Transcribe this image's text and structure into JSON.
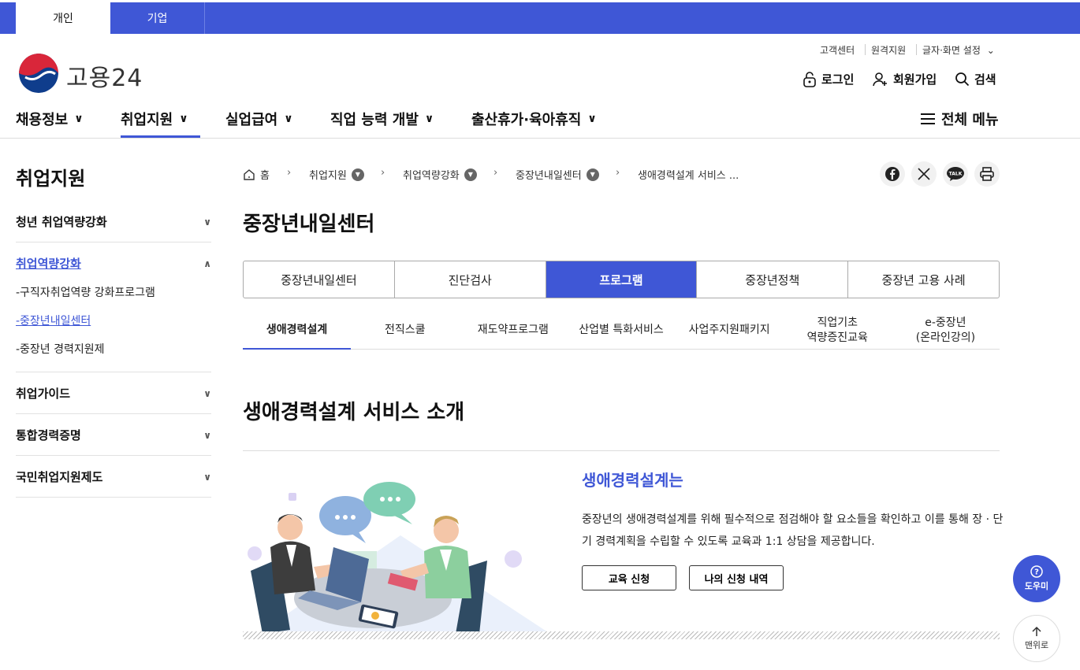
{
  "top_tabs": [
    "개인",
    "기업"
  ],
  "brand": {
    "name": "고용24"
  },
  "utility": {
    "customer_center": "고객센터",
    "remote_support": "원격지원",
    "display_settings": "글자·화면 설정"
  },
  "account": {
    "login": "로그인",
    "signup": "회원가입",
    "search": "검색"
  },
  "gnb": [
    "채용정보",
    "취업지원",
    "실업급여",
    "직업 능력 개발",
    "출산휴가·육아휴직"
  ],
  "all_menu": "전체 메뉴",
  "sidebar": {
    "title": "취업지원",
    "items": [
      {
        "label": "청년 취업역량강화"
      },
      {
        "label": "취업역량강화",
        "sub": [
          "-구직자취업역량 강화프로그램",
          "-중장년내일센터",
          "-중장년 경력지원제"
        ]
      },
      {
        "label": "취업가이드"
      },
      {
        "label": "통합경력증명"
      },
      {
        "label": "국민취업지원제도"
      }
    ]
  },
  "breadcrumb": [
    "홈",
    "취업지원",
    "취업역량강화",
    "중장년내일센터",
    "생애경력설계 서비스 ..."
  ],
  "page_title": "중장년내일센터",
  "tabs": [
    "중장년내일센터",
    "진단검사",
    "프로그램",
    "중장년정책",
    "중장년 고용 사례"
  ],
  "subtabs": [
    "생애경력설계",
    "전직스쿨",
    "재도약프로그램",
    "산업별 특화서비스",
    "사업주지원패키지",
    "직업기초\n역량증진교육",
    "e-중장년\n(온라인강의)"
  ],
  "section": {
    "title": "생애경력설계 서비스 소개",
    "heading": "생애경력설계는",
    "desc": "중장년의 생애경력설계를 위해 필수적으로 점검해야 할 요소들을 확인하고 이를 통해 장 · 단기 경력계획을 수립할 수 있도록 교육과 1:1 상담을 제공합니다.",
    "buttons": [
      "교육 신청",
      "나의 신청 내역"
    ]
  },
  "floating": {
    "help": "도우미",
    "top": "맨위로"
  },
  "colors": {
    "primary": "#3f57d6"
  }
}
